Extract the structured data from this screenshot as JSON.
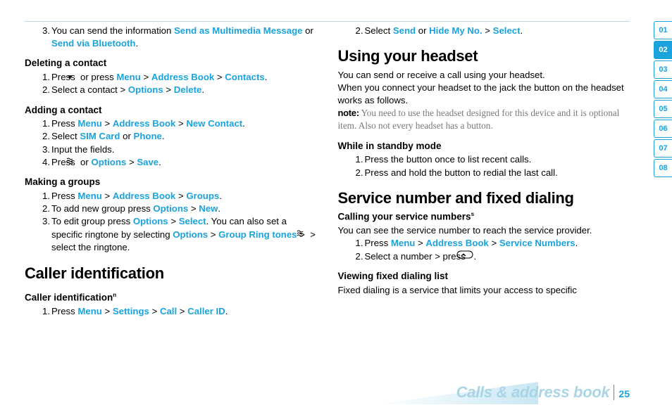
{
  "left": {
    "item3_a": "You can send the information ",
    "item3_b": "Send as Multimedia Message",
    "item3_c": " or ",
    "item3_d": "Send via Bluetooth",
    "deleting_h": "Deleting a contact",
    "del1_a": "Press ",
    "del1_b": " or press ",
    "del1_menu": "Menu",
    "del1_ab": "Address Book",
    "del1_contacts": "Contacts",
    "del2_a": "Select a contact > ",
    "del2_opt": "Options",
    "del2_del": "Delete",
    "adding_h": "Adding a contact",
    "add1_a": "Press ",
    "add1_menu": "Menu",
    "add1_ab": "Address Book",
    "add1_new": "New Contact",
    "add2_a": "Select ",
    "add2_sim": "SIM Card",
    "add2_or": " or ",
    "add2_phone": "Phone",
    "add3": "Input the fields.",
    "add4_a": "Press ",
    "add4_b": " or ",
    "add4_opt": "Options",
    "add4_save": "Save",
    "groups_h": "Making a groups",
    "grp1_a": "Press ",
    "grp1_menu": "Menu",
    "grp1_ab": "Address Book",
    "grp1_groups": "Groups",
    "grp2_a": "To add new group press ",
    "grp2_opt": "Options",
    "grp2_new": "New",
    "grp3_a": "To edit group press ",
    "grp3_opt": "Options",
    "grp3_sel": "Select",
    "grp3_b": ". You can also set a specific ringtone by selecting ",
    "grp3_opt2": "Options",
    "grp3_ring": "Group Ring tones",
    "grp3_c": " > ",
    "grp3_d": " > select the ringtone.",
    "caller_h": "Caller identification",
    "caller_sub": "Caller identification",
    "caller_sup": "n",
    "cid1_a": "Press ",
    "cid1_menu": "Menu",
    "cid1_set": "Settings",
    "cid1_call": "Call",
    "cid1_cid": "Caller ID"
  },
  "right": {
    "item2_a": "Select ",
    "item2_send": "Send",
    "item2_or": " or ",
    "item2_hide": "Hide My No.",
    "item2_sel": "Select",
    "headset_h": "Using your headset",
    "headset_p1": "You can send or receive a call using your headset.",
    "headset_p2": "When you connect your headset to the jack the button on the headset works as follows.",
    "note_label": "note:",
    "note_text": " You need to use the headset designed for this device and it is optional item. Also not every headset has a button.",
    "standby_h": "While in standby mode",
    "sb1": "Press the button once to list recent calls.",
    "sb2": "Press and hold the button to redial the last call.",
    "service_h": "Service number and fixed dialing",
    "calling_h": "Calling your service numbers",
    "calling_sup": "s",
    "calling_p": "You can see the service number to reach the service provider.",
    "sv1_a": "Press ",
    "sv1_menu": "Menu",
    "sv1_ab": "Address Book",
    "sv1_sn": "Service Numbers",
    "sv2_a": "Select a number > press ",
    "fixed_h": "Viewing fixed dialing list",
    "fixed_p": "Fixed dialing is a service that limits your access to specific"
  },
  "tabs": [
    "01",
    "02",
    "03",
    "04",
    "05",
    "06",
    "07",
    "08"
  ],
  "active_tab": 1,
  "footer_title": "Calls & address book",
  "page_number": "25"
}
